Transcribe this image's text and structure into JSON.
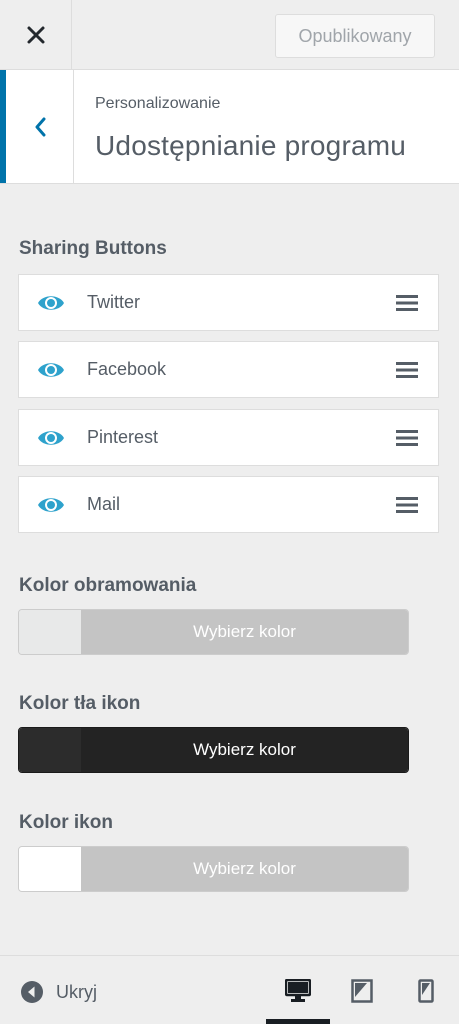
{
  "topbar": {
    "publish_label": "Opublikowany"
  },
  "section": {
    "breadcrumb": "Personalizowanie",
    "title": "Udostępnianie programu"
  },
  "sharing": {
    "label": "Sharing Buttons",
    "items": [
      {
        "label": "Twitter",
        "visible": true
      },
      {
        "label": "Facebook",
        "visible": true
      },
      {
        "label": "Pinterest",
        "visible": true
      },
      {
        "label": "Mail",
        "visible": true
      }
    ]
  },
  "colors": [
    {
      "label": "Kolor obramowania",
      "button_label": "Wybierz kolor",
      "swatch": "#e8e9e9",
      "button_bg": "#c4c4c4"
    },
    {
      "label": "Kolor tła ikon",
      "button_label": "Wybierz kolor",
      "swatch": "#2c2c2c",
      "button_bg": "#232323"
    },
    {
      "label": "Kolor ikon",
      "button_label": "Wybierz kolor",
      "swatch": "#ffffff",
      "button_bg": "#c4c4c4"
    }
  ],
  "footer": {
    "hide_label": "Ukryj",
    "devices": [
      "desktop-icon",
      "tablet-icon",
      "mobile-icon"
    ],
    "active_device": "desktop"
  },
  "accent": "#0073aa",
  "eye_color": "#2ea2cc"
}
